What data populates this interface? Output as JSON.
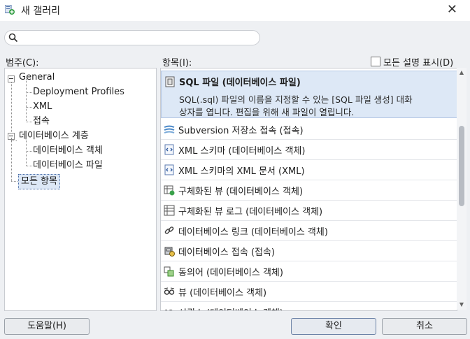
{
  "window": {
    "title": "새 갤러리",
    "close_glyph": "✕"
  },
  "search": {
    "placeholder": "",
    "value": ""
  },
  "categories": {
    "label": "범주(C):",
    "tree": [
      {
        "label": "General",
        "expanded": true
      },
      {
        "label": "Deployment Profiles"
      },
      {
        "label": "XML"
      },
      {
        "label": "접속"
      },
      {
        "label": "데이터베이스 계층",
        "expanded": true
      },
      {
        "label": "데이터베이스 객체"
      },
      {
        "label": "데이터베이스 파일"
      },
      {
        "label": "모든 항목",
        "selected": true
      }
    ]
  },
  "items_panel": {
    "label": "항목(I):",
    "show_all_desc_label": "모든 설명 표시(D)",
    "show_all_desc_checked": false,
    "selected_item": {
      "title": "SQL 파일 (데이터베이스 파일)",
      "desc_line1": "SQL(.sql) 파일의 이름을 지정할 수 있는 [SQL 파일 생성] 대화",
      "desc_line2": "상자를 엽니다. 편집을 위해 새 파일이 열립니다.",
      "icon": "sql-file-icon"
    },
    "items": [
      {
        "label": "Subversion 저장소 접속 (접속)",
        "icon": "subversion-icon"
      },
      {
        "label": "XML 스키마 (데이터베이스 객체)",
        "icon": "xml-schema-icon"
      },
      {
        "label": "XML 스키마의 XML 문서 (XML)",
        "icon": "xml-document-icon"
      },
      {
        "label": "구체화된 뷰 (데이터베이스 객체)",
        "icon": "materialized-view-icon"
      },
      {
        "label": "구체화된 뷰 로그 (데이터베이스 객체)",
        "icon": "materialized-view-log-icon"
      },
      {
        "label": "데이터베이스 링크 (데이터베이스 객체)",
        "icon": "database-link-icon"
      },
      {
        "label": "데이터베이스 접속 (접속)",
        "icon": "database-connection-icon"
      },
      {
        "label": "동의어 (데이터베이스 객체)",
        "icon": "synonym-icon"
      },
      {
        "label": "뷰 (데이터베이스 객체)",
        "icon": "view-icon"
      },
      {
        "label": "시퀀스 (데이터베이스 객체)",
        "icon": "sequence-icon"
      }
    ]
  },
  "buttons": {
    "help": "도움말(H)",
    "ok": "확인",
    "cancel": "취소"
  },
  "colors": {
    "selection": "#dde8f6",
    "background": "#eef0f3",
    "accent": "#4a6da6"
  }
}
